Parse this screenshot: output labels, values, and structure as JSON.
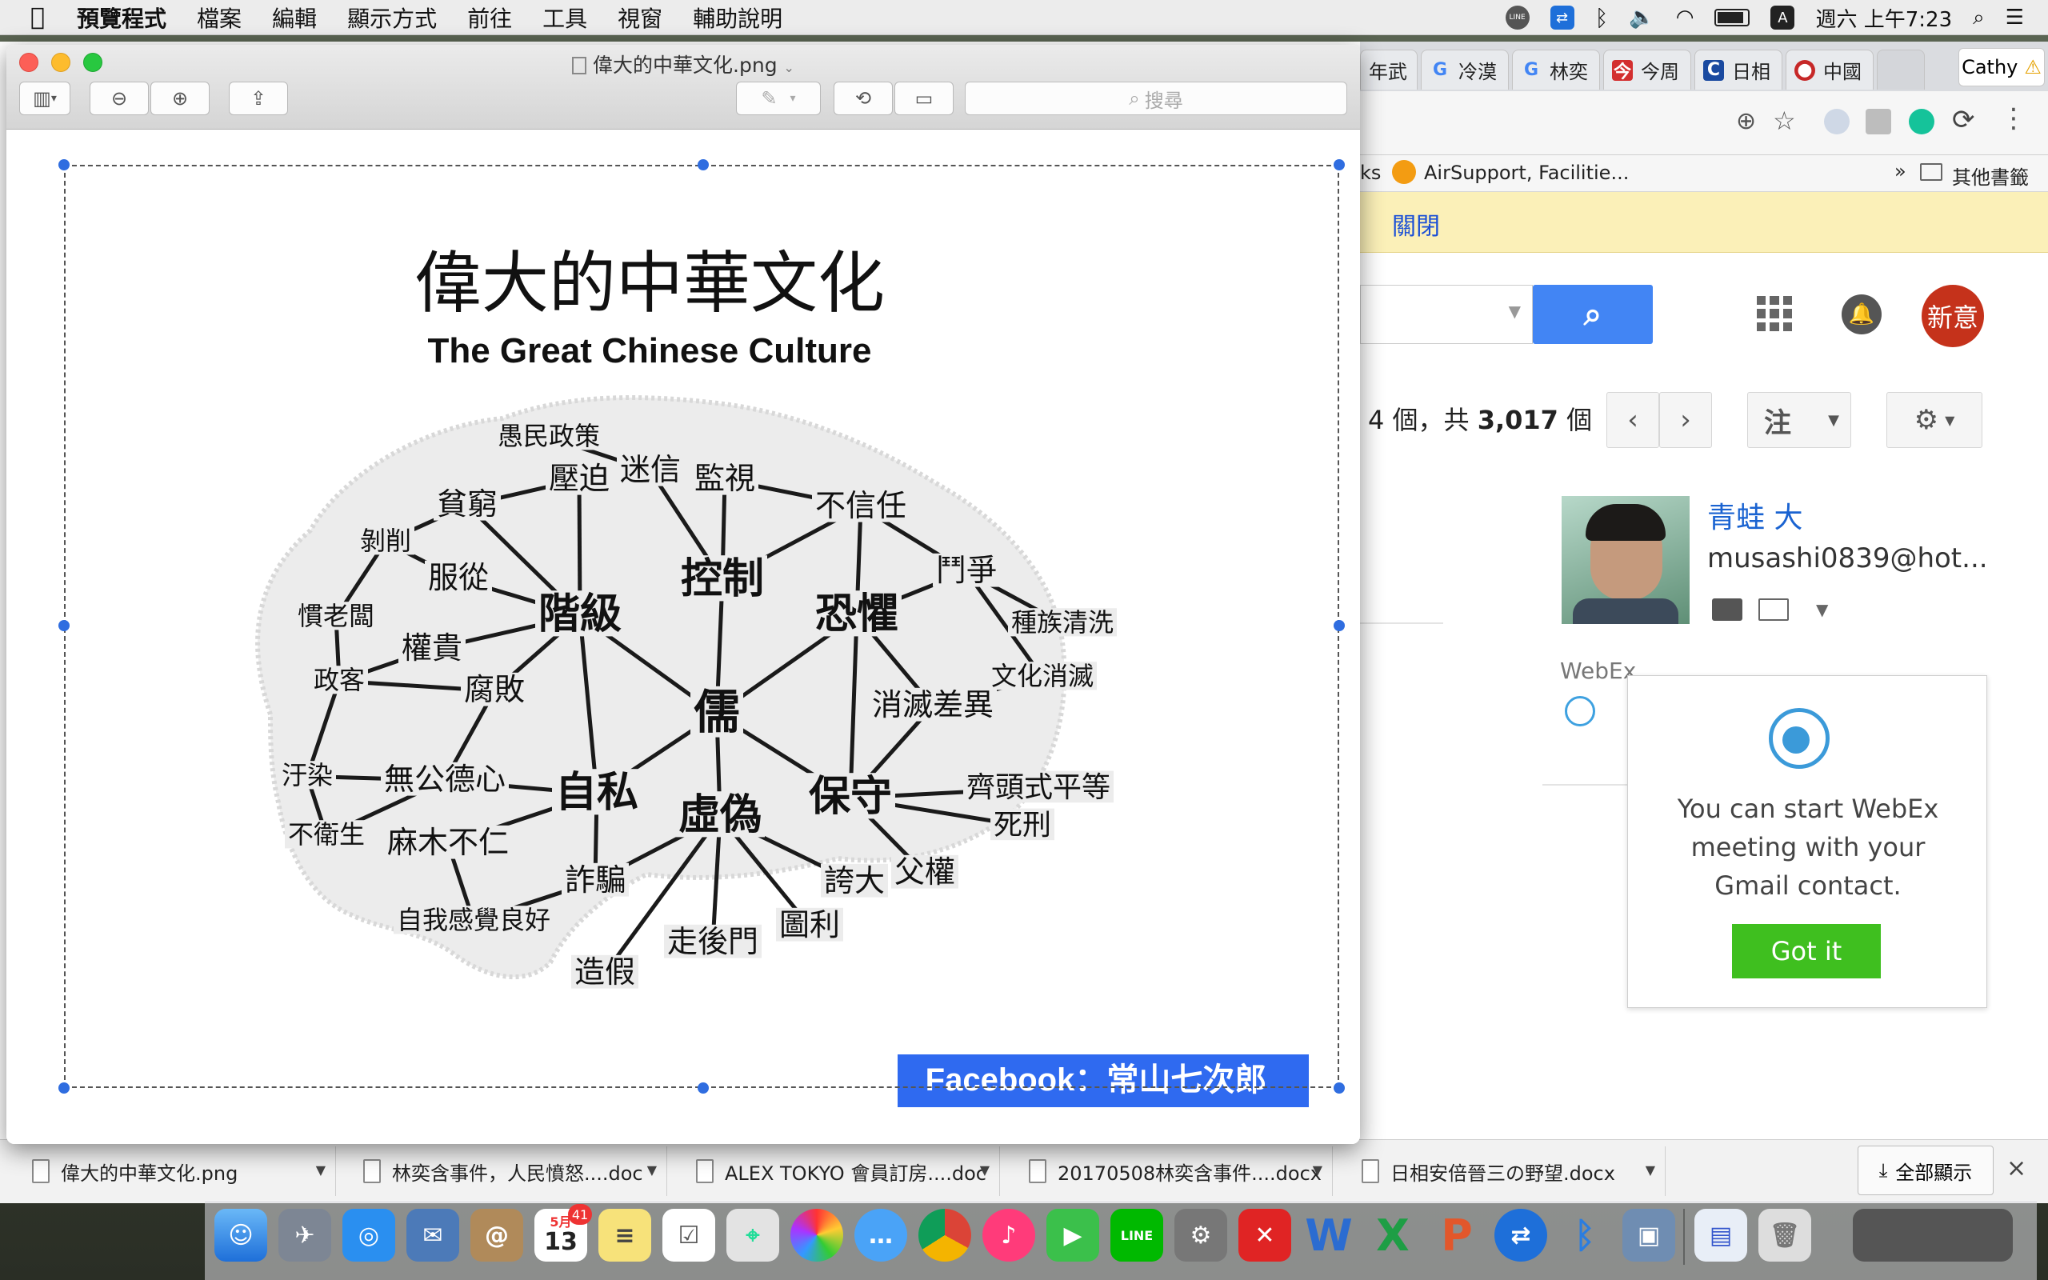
{
  "menubar": {
    "app_name": "預覽程式",
    "items": [
      "檔案",
      "編輯",
      "顯示方式",
      "前往",
      "工具",
      "視窗",
      "輔助說明"
    ],
    "clock": "週六 上午7:23",
    "input_badge": "A",
    "line_badge": "LINE"
  },
  "chrome": {
    "tabs": [
      "年武",
      "冷漠",
      "林奕",
      "今周",
      "日相",
      "中國"
    ],
    "profile_name": "Cathy",
    "bookmarks": {
      "partial": "ks",
      "airsupport": "AirSupport, Facilitie...",
      "more": "»",
      "other": "其他書籤"
    },
    "notice_link": "關閉"
  },
  "gmail": {
    "avatar_text": "新意",
    "pager": {
      "range_end": "4 個，共",
      "total": "3,017",
      "suffix": "個"
    },
    "more_button": "注",
    "contact_name": "青蛙 大",
    "contact_email": "musashi0839@hot...",
    "webex_label": "WebEx",
    "popup_message": [
      "You can start WebEx",
      "meeting with your",
      "Gmail contact."
    ],
    "popup_button": "Got it"
  },
  "downloads": {
    "items": [
      "偉大的中華文化.png",
      "林奕含事件，人民憤怒....doc",
      "ALEX TOKYO 會員訂房....doc",
      "20170508林奕含事件....docx",
      "日相安倍晉三の野望.docx"
    ],
    "show_all": "全部顯示",
    "close": "×"
  },
  "preview": {
    "title": "偉大的中華文化.png",
    "search_placeholder": "搜尋",
    "image": {
      "title_zh": "偉大的中華文化",
      "title_en": "The Great Chinese Culture",
      "credit": "Facebook：常山七次郎",
      "nodes": {
        "ru": "儒",
        "kongzhi": "控制",
        "jieji": "階級",
        "kongju": "恐懼",
        "zisi": "自私",
        "xuwei": "虛偽",
        "baoshou": "保守",
        "yumin": "愚民政策",
        "mixin": "迷信",
        "jianshi": "監視",
        "buxinren": "不信任",
        "yapo": "壓迫",
        "pinqiong": "貧窮",
        "boxue": "剝削",
        "fucong": "服從",
        "guanlao": "慣老闆",
        "quangui": "權貴",
        "zhengshang": "政客",
        "fubai": "腐敗",
        "douzheng": "鬥爭",
        "zhongzu": "種族清洗",
        "wenhua": "文化消滅",
        "xiaomie": "消滅差異",
        "wugong": "無公德心",
        "wuran": "汙染",
        "buweisheng": "不衛生",
        "mamu": "麻木不仁",
        "zhapian": "詐騙",
        "ziwo": "自我感覺良好",
        "zaojia": "造假",
        "zouhoumen": "走後門",
        "tuli": "圖利",
        "kuada": "誇大",
        "fuquan": "父權",
        "qitou": "齊頭式平等",
        "sixing": "死刑"
      }
    }
  },
  "dock": {
    "calendar_month": "5月",
    "calendar_day": "13",
    "calendar_badge": "41"
  }
}
